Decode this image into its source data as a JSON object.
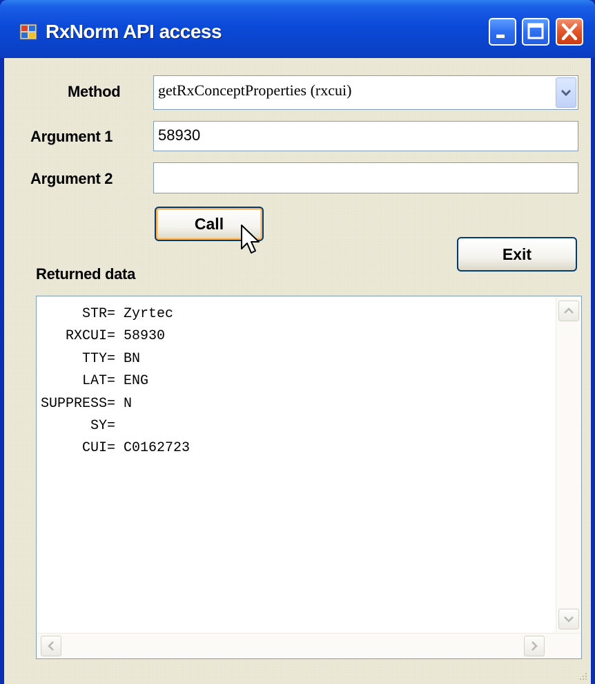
{
  "window": {
    "title": "RxNorm API access"
  },
  "form": {
    "method_label": "Method",
    "method_value": "getRxConceptProperties (rxcui)",
    "arg1_label": "Argument 1",
    "arg1_value": "58930",
    "arg2_label": "Argument 2",
    "arg2_value": "",
    "call_label": "Call",
    "exit_label": "Exit",
    "returned_label": "Returned data"
  },
  "output": {
    "text": "     STR= Zyrtec\n   RXCUI= 58930\n     TTY= BN\n     LAT= ENG\nSUPPRESS= N\n      SY=\n     CUI= C0162723"
  },
  "icons": {
    "app": "app-window-icon",
    "minimize": "minimize-icon",
    "maximize": "maximize-icon",
    "close": "close-icon",
    "dropdown": "chevron-down-icon",
    "cursor": "mouse-pointer-icon"
  },
  "colors": {
    "titlebar": "#0b4ad8",
    "client_bg": "#ece9d8",
    "close_button": "#e4592f",
    "focus_outline": "#f8b25a"
  }
}
